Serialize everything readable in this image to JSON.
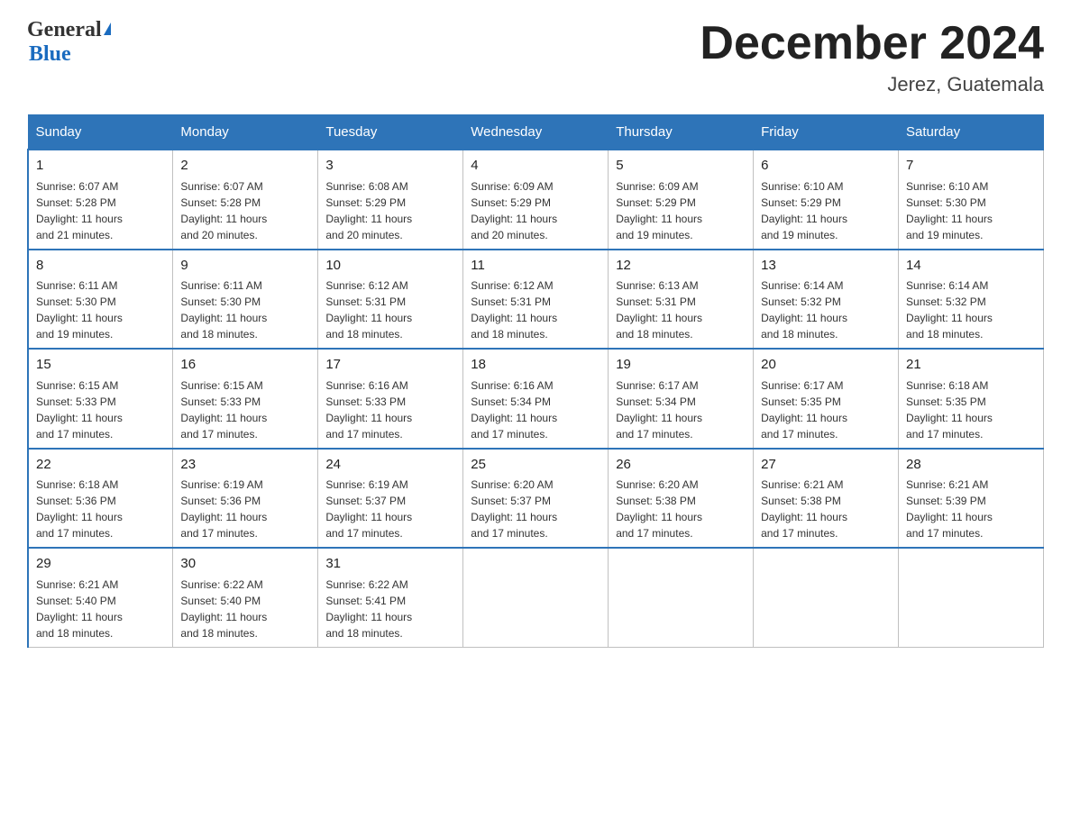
{
  "header": {
    "logo_general": "General",
    "logo_blue": "Blue",
    "title": "December 2024",
    "subtitle": "Jerez, Guatemala"
  },
  "days_of_week": [
    "Sunday",
    "Monday",
    "Tuesday",
    "Wednesday",
    "Thursday",
    "Friday",
    "Saturday"
  ],
  "weeks": [
    [
      {
        "day": "1",
        "sunrise": "6:07 AM",
        "sunset": "5:28 PM",
        "daylight": "11 hours and 21 minutes."
      },
      {
        "day": "2",
        "sunrise": "6:07 AM",
        "sunset": "5:28 PM",
        "daylight": "11 hours and 20 minutes."
      },
      {
        "day": "3",
        "sunrise": "6:08 AM",
        "sunset": "5:29 PM",
        "daylight": "11 hours and 20 minutes."
      },
      {
        "day": "4",
        "sunrise": "6:09 AM",
        "sunset": "5:29 PM",
        "daylight": "11 hours and 20 minutes."
      },
      {
        "day": "5",
        "sunrise": "6:09 AM",
        "sunset": "5:29 PM",
        "daylight": "11 hours and 19 minutes."
      },
      {
        "day": "6",
        "sunrise": "6:10 AM",
        "sunset": "5:29 PM",
        "daylight": "11 hours and 19 minutes."
      },
      {
        "day": "7",
        "sunrise": "6:10 AM",
        "sunset": "5:30 PM",
        "daylight": "11 hours and 19 minutes."
      }
    ],
    [
      {
        "day": "8",
        "sunrise": "6:11 AM",
        "sunset": "5:30 PM",
        "daylight": "11 hours and 19 minutes."
      },
      {
        "day": "9",
        "sunrise": "6:11 AM",
        "sunset": "5:30 PM",
        "daylight": "11 hours and 18 minutes."
      },
      {
        "day": "10",
        "sunrise": "6:12 AM",
        "sunset": "5:31 PM",
        "daylight": "11 hours and 18 minutes."
      },
      {
        "day": "11",
        "sunrise": "6:12 AM",
        "sunset": "5:31 PM",
        "daylight": "11 hours and 18 minutes."
      },
      {
        "day": "12",
        "sunrise": "6:13 AM",
        "sunset": "5:31 PM",
        "daylight": "11 hours and 18 minutes."
      },
      {
        "day": "13",
        "sunrise": "6:14 AM",
        "sunset": "5:32 PM",
        "daylight": "11 hours and 18 minutes."
      },
      {
        "day": "14",
        "sunrise": "6:14 AM",
        "sunset": "5:32 PM",
        "daylight": "11 hours and 18 minutes."
      }
    ],
    [
      {
        "day": "15",
        "sunrise": "6:15 AM",
        "sunset": "5:33 PM",
        "daylight": "11 hours and 17 minutes."
      },
      {
        "day": "16",
        "sunrise": "6:15 AM",
        "sunset": "5:33 PM",
        "daylight": "11 hours and 17 minutes."
      },
      {
        "day": "17",
        "sunrise": "6:16 AM",
        "sunset": "5:33 PM",
        "daylight": "11 hours and 17 minutes."
      },
      {
        "day": "18",
        "sunrise": "6:16 AM",
        "sunset": "5:34 PM",
        "daylight": "11 hours and 17 minutes."
      },
      {
        "day": "19",
        "sunrise": "6:17 AM",
        "sunset": "5:34 PM",
        "daylight": "11 hours and 17 minutes."
      },
      {
        "day": "20",
        "sunrise": "6:17 AM",
        "sunset": "5:35 PM",
        "daylight": "11 hours and 17 minutes."
      },
      {
        "day": "21",
        "sunrise": "6:18 AM",
        "sunset": "5:35 PM",
        "daylight": "11 hours and 17 minutes."
      }
    ],
    [
      {
        "day": "22",
        "sunrise": "6:18 AM",
        "sunset": "5:36 PM",
        "daylight": "11 hours and 17 minutes."
      },
      {
        "day": "23",
        "sunrise": "6:19 AM",
        "sunset": "5:36 PM",
        "daylight": "11 hours and 17 minutes."
      },
      {
        "day": "24",
        "sunrise": "6:19 AM",
        "sunset": "5:37 PM",
        "daylight": "11 hours and 17 minutes."
      },
      {
        "day": "25",
        "sunrise": "6:20 AM",
        "sunset": "5:37 PM",
        "daylight": "11 hours and 17 minutes."
      },
      {
        "day": "26",
        "sunrise": "6:20 AM",
        "sunset": "5:38 PM",
        "daylight": "11 hours and 17 minutes."
      },
      {
        "day": "27",
        "sunrise": "6:21 AM",
        "sunset": "5:38 PM",
        "daylight": "11 hours and 17 minutes."
      },
      {
        "day": "28",
        "sunrise": "6:21 AM",
        "sunset": "5:39 PM",
        "daylight": "11 hours and 17 minutes."
      }
    ],
    [
      {
        "day": "29",
        "sunrise": "6:21 AM",
        "sunset": "5:40 PM",
        "daylight": "11 hours and 18 minutes."
      },
      {
        "day": "30",
        "sunrise": "6:22 AM",
        "sunset": "5:40 PM",
        "daylight": "11 hours and 18 minutes."
      },
      {
        "day": "31",
        "sunrise": "6:22 AM",
        "sunset": "5:41 PM",
        "daylight": "11 hours and 18 minutes."
      },
      null,
      null,
      null,
      null
    ]
  ],
  "sunrise_label": "Sunrise:",
  "sunset_label": "Sunset:",
  "daylight_label": "Daylight:"
}
